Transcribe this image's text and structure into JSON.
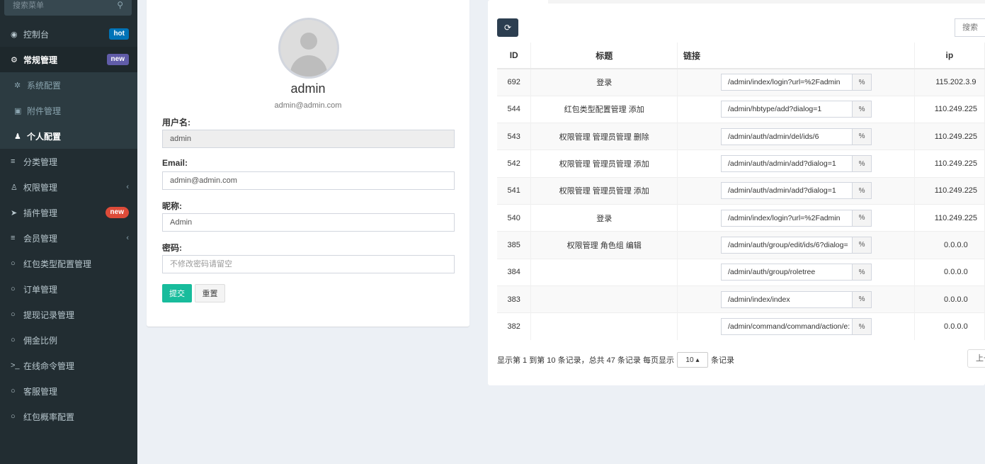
{
  "sidebar": {
    "search_placeholder": "搜索菜单",
    "items": [
      {
        "icon": "dashboard-icon",
        "glyph": "◉",
        "label": "控制台",
        "badge": "hot"
      },
      {
        "icon": "cogs-icon",
        "glyph": "⚙",
        "label": "常规管理",
        "badge": "new"
      },
      {
        "icon": "cog-icon",
        "glyph": "✲",
        "label": "系统配置"
      },
      {
        "icon": "attachment-icon",
        "glyph": "▣",
        "label": "附件管理"
      },
      {
        "icon": "user-icon",
        "glyph": "♟",
        "label": "个人配置"
      },
      {
        "icon": "list-icon",
        "glyph": "≡",
        "label": "分类管理"
      },
      {
        "icon": "group-icon",
        "glyph": "♙",
        "label": "权限管理"
      },
      {
        "icon": "rocket-icon",
        "glyph": "➤",
        "label": "插件管理",
        "badge": "new"
      },
      {
        "icon": "list-icon",
        "glyph": "≡",
        "label": "会员管理"
      },
      {
        "icon": "circle-icon",
        "glyph": "○",
        "label": "红包类型配置管理"
      },
      {
        "icon": "circle-icon",
        "glyph": "○",
        "label": "订单管理"
      },
      {
        "icon": "circle-icon",
        "glyph": "○",
        "label": "提现记录管理"
      },
      {
        "icon": "circle-icon",
        "glyph": "○",
        "label": "佣金比例"
      },
      {
        "icon": "terminal-icon",
        "glyph": ">_",
        "label": "在线命令管理"
      },
      {
        "icon": "circle-icon",
        "glyph": "○",
        "label": "客服管理"
      },
      {
        "icon": "circle-icon",
        "glyph": "○",
        "label": "红包概率配置"
      }
    ],
    "chevron": "‹"
  },
  "profile": {
    "name": "admin",
    "email": "admin@admin.com",
    "username_label": "用户名:",
    "username_value": "admin",
    "email_label": "Email:",
    "email_value": "admin@admin.com",
    "nickname_label": "昵称:",
    "nickname_value": "Admin",
    "password_label": "密码:",
    "password_placeholder": "不修改密码请留空",
    "submit_label": "提交",
    "reset_label": "重置"
  },
  "log": {
    "refresh_glyph": "⟳",
    "search_placeholder": "搜索",
    "columns": [
      "ID",
      "标题",
      "链接",
      "ip"
    ],
    "link_glyph": "%",
    "rows": [
      {
        "id": "692",
        "title": "登录",
        "url": "/admin/index/login?url=%2Fadmin",
        "ip": "115.202.3.9"
      },
      {
        "id": "544",
        "title": "红包类型配置管理 添加",
        "url": "/admin/hbtype/add?dialog=1",
        "ip": "110.249.225"
      },
      {
        "id": "543",
        "title": "权限管理 管理员管理 删除",
        "url": "/admin/auth/admin/del/ids/6",
        "ip": "110.249.225"
      },
      {
        "id": "542",
        "title": "权限管理 管理员管理 添加",
        "url": "/admin/auth/admin/add?dialog=1",
        "ip": "110.249.225"
      },
      {
        "id": "541",
        "title": "权限管理 管理员管理 添加",
        "url": "/admin/auth/admin/add?dialog=1",
        "ip": "110.249.225"
      },
      {
        "id": "540",
        "title": "登录",
        "url": "/admin/index/login?url=%2Fadmin",
        "ip": "110.249.225"
      },
      {
        "id": "385",
        "title": "权限管理 角色组 编辑",
        "url": "/admin/auth/group/edit/ids/6?dialog=",
        "ip": "0.0.0.0"
      },
      {
        "id": "384",
        "title": "",
        "url": "/admin/auth/group/roletree",
        "ip": "0.0.0.0"
      },
      {
        "id": "383",
        "title": "",
        "url": "/admin/index/index",
        "ip": "0.0.0.0"
      },
      {
        "id": "382",
        "title": "",
        "url": "/admin/command/command/action/e:",
        "ip": "0.0.0.0"
      }
    ],
    "pagination_prefix": "显示第 1 到第 10 条记录，总共 47 条记录 每页显示",
    "page_size": "10",
    "page_size_caret": "▴",
    "pagination_suffix": "条记录",
    "prev_label": "上一页"
  }
}
